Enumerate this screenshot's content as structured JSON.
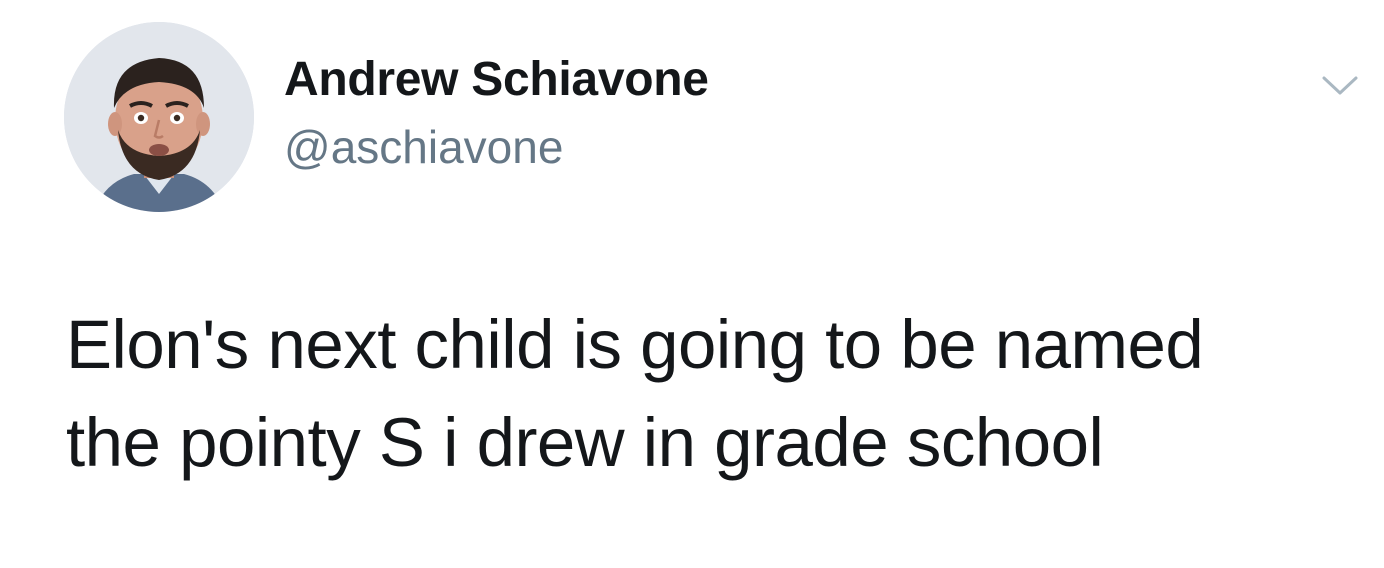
{
  "author": {
    "display_name": "Andrew Schiavone",
    "handle": "@aschiavone",
    "avatar_icon": "user-avatar-photo"
  },
  "tweet": {
    "text_lines": [
      "Elon's next child is going to be named",
      "the pointy S i drew in grade school"
    ]
  },
  "controls": {
    "menu_icon": "chevron-down-icon"
  },
  "colors": {
    "text_primary": "#14171a",
    "text_secondary": "#657786",
    "chevron": "#aab8c2",
    "background": "#ffffff"
  }
}
